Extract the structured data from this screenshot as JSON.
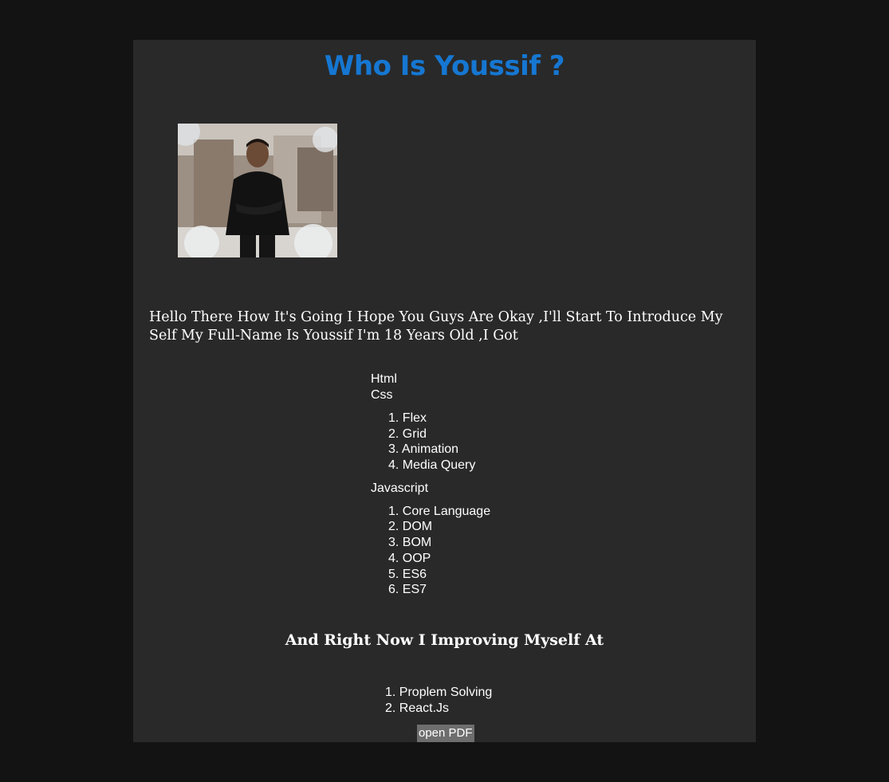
{
  "page": {
    "title": "Who Is Youssif ?",
    "intro_text": "Hello There How It's Going I Hope You Guys Are Okay ,I'll Start To Introduce My Self My Full-Name Is Youssif I'm 18 Years Old ,I Got",
    "improving_heading": "And Right Now I Improving Myself At",
    "pdf_button_label": "open PDF"
  },
  "skills": {
    "html": "Html",
    "css": {
      "label": "Css",
      "items": [
        "1. Flex",
        "2. Grid",
        "3. Animation",
        "4. Media Query"
      ]
    },
    "javascript": {
      "label": "Javascript",
      "items": [
        "1. Core Language",
        "2. DOM",
        "3. BOM",
        "4. OOP",
        "5. ES6",
        "6. ES7"
      ]
    }
  },
  "goals": [
    "1. Proplem Solving",
    "2. React.Js"
  ],
  "colors": {
    "page_background": "#131313",
    "card_background": "#292929",
    "title_color": "#1677d2",
    "button_background": "#6e6e6e",
    "text_color": "#ffffff"
  }
}
